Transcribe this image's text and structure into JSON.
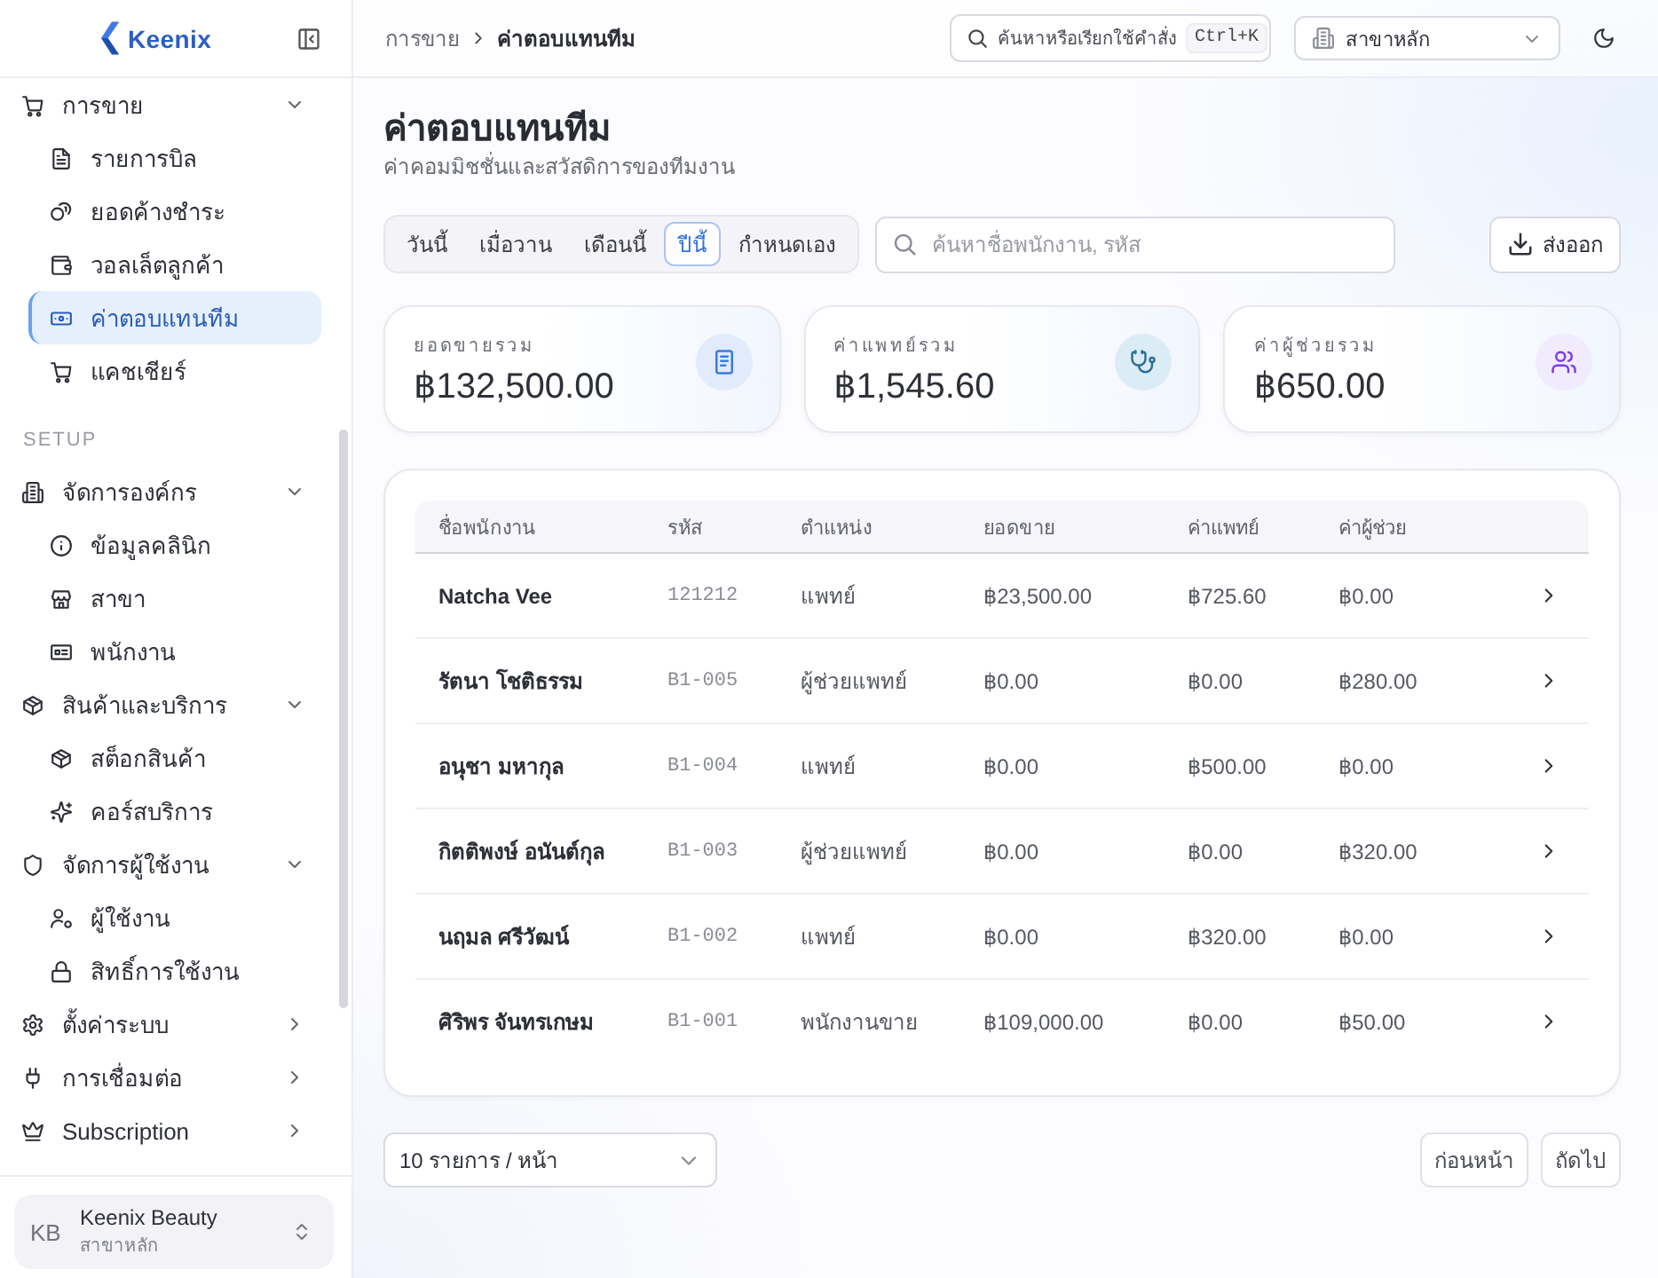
{
  "sidebar": {
    "logo": "Keenix",
    "nav": [
      {
        "kind": "group",
        "label": "การขาย",
        "expanded": true,
        "children": [
          {
            "label": "รายการบิล",
            "selected": false
          },
          {
            "label": "ยอดค้างชำระ",
            "selected": false
          },
          {
            "label": "วอลเล็ตลูกค้า",
            "selected": false
          },
          {
            "label": "ค่าตอบแทนทีม",
            "selected": true
          },
          {
            "label": "แคชเชียร์",
            "selected": false
          }
        ]
      },
      {
        "kind": "section",
        "label": "SETUP"
      },
      {
        "kind": "group",
        "label": "จัดการองค์กร",
        "expanded": true,
        "children": [
          {
            "label": "ข้อมูลคลินิก",
            "selected": false
          },
          {
            "label": "สาขา",
            "selected": false
          },
          {
            "label": "พนักงาน",
            "selected": false
          }
        ]
      },
      {
        "kind": "group",
        "label": "สินค้าและบริการ",
        "expanded": true,
        "children": [
          {
            "label": "สต็อกสินค้า",
            "selected": false
          },
          {
            "label": "คอร์สบริการ",
            "selected": false
          }
        ]
      },
      {
        "kind": "group",
        "label": "จัดการผู้ใช้งาน",
        "expanded": true,
        "children": [
          {
            "label": "ผู้ใช้งาน",
            "selected": false
          },
          {
            "label": "สิทธิ์การใช้งาน",
            "selected": false
          }
        ]
      },
      {
        "kind": "group",
        "label": "ตั้งค่าระบบ",
        "expanded": false
      },
      {
        "kind": "group",
        "label": "การเชื่อมต่อ",
        "expanded": false
      },
      {
        "kind": "group",
        "label": "Subscription",
        "expanded": false
      }
    ],
    "account": {
      "initials": "KB",
      "name": "Keenix Beauty",
      "branch": "สาขาหลัก"
    }
  },
  "header": {
    "breadcrumb": [
      "การขาย",
      "ค่าตอบแทนทีม"
    ],
    "command_search": {
      "placeholder": "ค้นหาหรือเรียกใช้คำสั่ง",
      "shortcut": "Ctrl+K"
    },
    "branch_select": {
      "value": "สาขาหลัก"
    }
  },
  "page": {
    "title": "ค่าตอบแทนทีม",
    "subtitle": "ค่าคอมมิชชั่นและสวัสดิการของทีมงาน"
  },
  "period_tabs": [
    {
      "label": "วันนี้",
      "selected": false
    },
    {
      "label": "เมื่อวาน",
      "selected": false
    },
    {
      "label": "เดือนนี้",
      "selected": false
    },
    {
      "label": "ปีนี้",
      "selected": true
    },
    {
      "label": "กำหนดเอง",
      "selected": false
    }
  ],
  "employee_search": {
    "placeholder": "ค้นหาชื่อพนักงาน, รหัส"
  },
  "export_button": "ส่งออก",
  "stats": [
    {
      "kind": "sales",
      "label": "ยอดขายรวม",
      "value": "฿132,500.00"
    },
    {
      "kind": "doctor",
      "label": "ค่าแพทย์รวม",
      "value": "฿1,545.60"
    },
    {
      "kind": "assistant",
      "label": "ค่าผู้ช่วยรวม",
      "value": "฿650.00"
    }
  ],
  "table": {
    "columns": [
      "ชื่อพนักงาน",
      "รหัส",
      "ตำแหน่ง",
      "ยอดขาย",
      "ค่าแพทย์",
      "ค่าผู้ช่วย"
    ],
    "rows": [
      {
        "name": "Natcha Vee",
        "code": "121212",
        "position": "แพทย์",
        "sales": "฿23,500.00",
        "doctor_fee": "฿725.60",
        "assistant_fee": "฿0.00"
      },
      {
        "name": "รัตนา โชติธรรม",
        "code": "B1-005",
        "position": "ผู้ช่วยแพทย์",
        "sales": "฿0.00",
        "doctor_fee": "฿0.00",
        "assistant_fee": "฿280.00"
      },
      {
        "name": "อนุชา มหากุล",
        "code": "B1-004",
        "position": "แพทย์",
        "sales": "฿0.00",
        "doctor_fee": "฿500.00",
        "assistant_fee": "฿0.00"
      },
      {
        "name": "กิตติพงษ์ อนันต์กุล",
        "code": "B1-003",
        "position": "ผู้ช่วยแพทย์",
        "sales": "฿0.00",
        "doctor_fee": "฿0.00",
        "assistant_fee": "฿320.00"
      },
      {
        "name": "นฤมล ศรีวัฒน์",
        "code": "B1-002",
        "position": "แพทย์",
        "sales": "฿0.00",
        "doctor_fee": "฿320.00",
        "assistant_fee": "฿0.00"
      },
      {
        "name": "ศิริพร จันทรเกษม",
        "code": "B1-001",
        "position": "พนักงานขาย",
        "sales": "฿109,000.00",
        "doctor_fee": "฿0.00",
        "assistant_fee": "฿50.00"
      }
    ]
  },
  "pagination": {
    "page_size": {
      "value": "10 รายการ / หน้า"
    },
    "buttons": [
      "ก่อนหน้า",
      "ถัดไป"
    ]
  }
}
